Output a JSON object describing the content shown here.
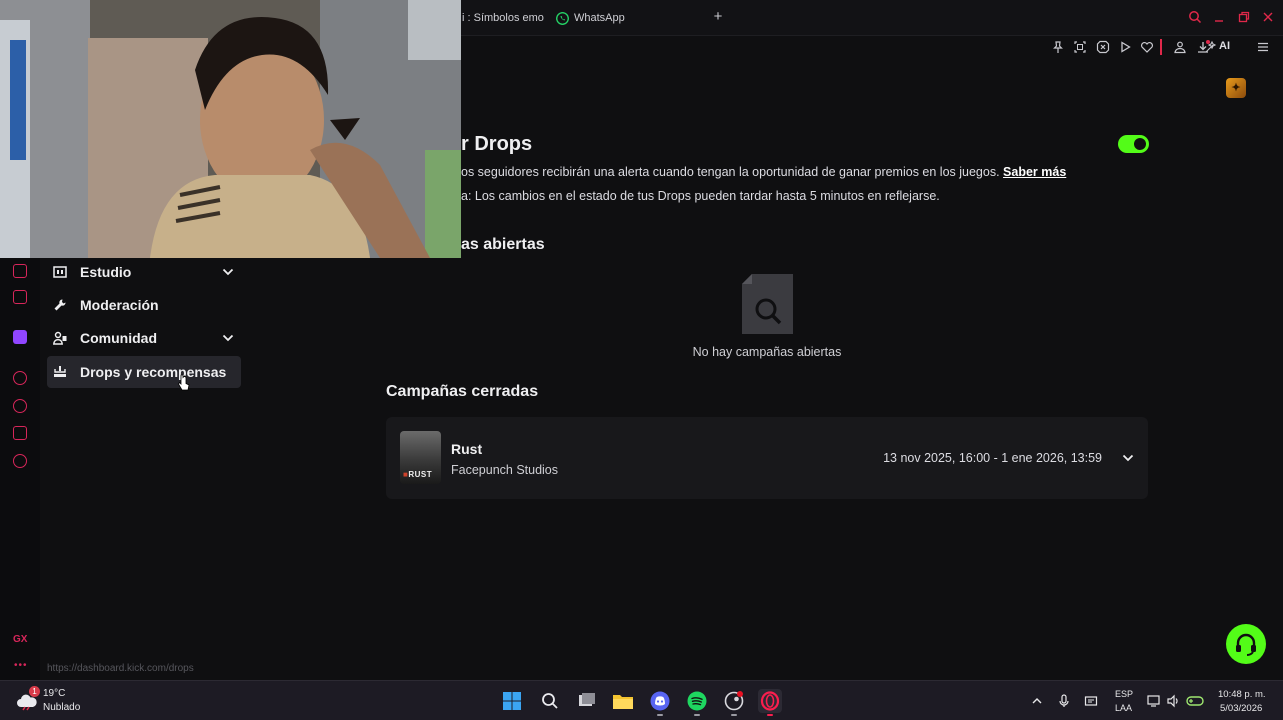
{
  "browser": {
    "tabs": [
      {
        "label": "i : Símbolos emo",
        "icon": "kick-icon"
      },
      {
        "label": "WhatsApp",
        "icon": "whatsapp-icon"
      }
    ],
    "toolbar_ai_label": "AI"
  },
  "sidebar": {
    "items": [
      {
        "label": "Estudio",
        "icon": "studio-icon",
        "expandable": true
      },
      {
        "label": "Moderación",
        "icon": "wrench-icon",
        "expandable": false
      },
      {
        "label": "Comunidad",
        "icon": "community-icon",
        "expandable": true
      },
      {
        "label": "Drops y recompensas",
        "icon": "drops-icon",
        "expandable": false,
        "active": true
      }
    ]
  },
  "main": {
    "drops_title": "r Drops",
    "drops_enabled": true,
    "drops_desc": "os seguidores recibirán una alerta cuando tengan la oportunidad de ganar premios en los juegos.",
    "learn_more": "Saber más",
    "drops_note": "a: Los cambios en el estado de tus Drops pueden tardar hasta 5 minutos en reflejarse.",
    "open_title": "as abiertas",
    "empty_text": "No hay campañas abiertas",
    "closed_title": "Campañas cerradas",
    "campaigns": [
      {
        "name": "Rust",
        "developer": "Facepunch Studios",
        "dates": "13 nov 2025, 16:00 - 1 ene 2026, 13:59",
        "logo_text": "RUST"
      }
    ]
  },
  "status_url": "https://dashboard.kick.com/drops",
  "taskbar": {
    "weather_temp": "19°C",
    "weather_desc": "Nublado",
    "weather_badge": "1",
    "lang_line1": "ESP",
    "lang_line2": "LAA",
    "time": "10:48 p. m.",
    "date": "5/03/2026"
  },
  "colors": {
    "kick_green": "#53fc18",
    "opera_red": "#e0284a",
    "background": "#0f0f11",
    "card": "#18181b"
  }
}
